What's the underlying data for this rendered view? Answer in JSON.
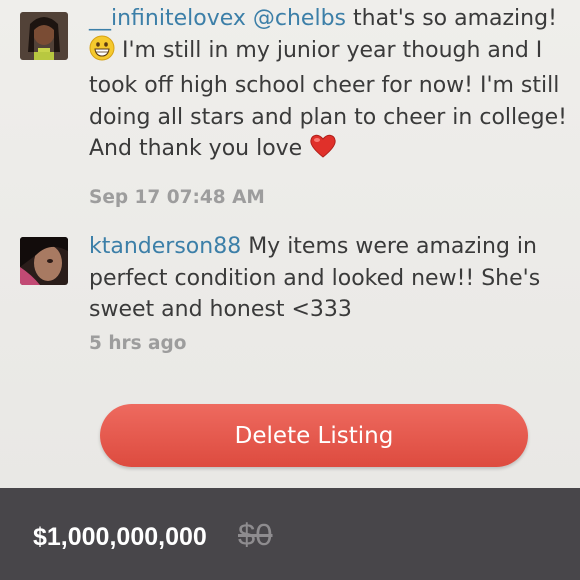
{
  "comments": [
    {
      "username": "__infinitelovex",
      "mention": "@chelbs",
      "text_a": "that's so amazing!",
      "emoji": "grinning-face",
      "text_b": "I'm still in my junior year though and I took off high school cheer for now! I'm still doing all stars and plan to cheer in college! And thank you love",
      "trailing_emoji": "red-heart",
      "timestamp": "Sep 17 07:48 AM"
    },
    {
      "username": "ktanderson88",
      "text": "My items were amazing in perfect condition and looked new!! She's sweet and honest <333",
      "timestamp": "5 hrs ago"
    }
  ],
  "actions": {
    "delete_label": "Delete Listing"
  },
  "listing": {
    "price": "$1,000,000,000",
    "original_price": "$0"
  },
  "colors": {
    "username": "#3c7fa8",
    "delete_button": "#e4564a",
    "price_bar": "#48464a"
  }
}
